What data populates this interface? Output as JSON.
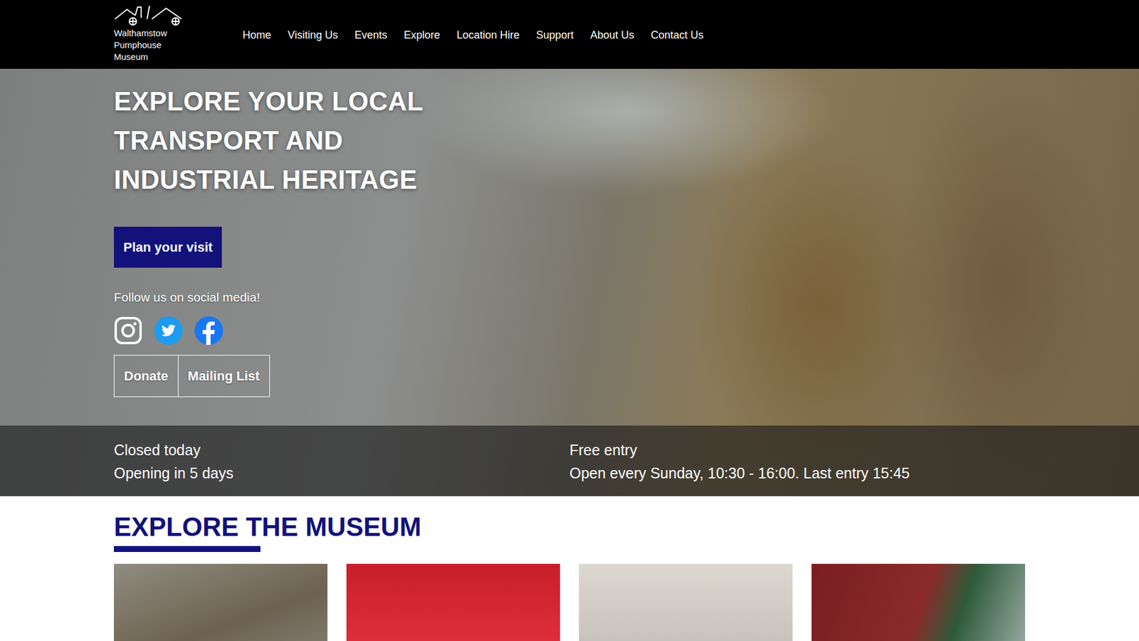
{
  "header": {
    "logo_lines": [
      "Walthamstow",
      "Pumphouse",
      "Museum"
    ],
    "nav": [
      {
        "label": "Home"
      },
      {
        "label": "Visiting Us"
      },
      {
        "label": "Events"
      },
      {
        "label": "Explore"
      },
      {
        "label": "Location Hire"
      },
      {
        "label": "Support"
      },
      {
        "label": "About Us"
      },
      {
        "label": "Contact Us"
      }
    ]
  },
  "hero": {
    "heading": "EXPLORE YOUR LOCAL TRANSPORT AND INDUSTRIAL HERITAGE",
    "plan_button": "Plan your visit",
    "social_label": "Follow us on social media!",
    "actions": [
      "Donate",
      "Mailing List"
    ]
  },
  "status": {
    "today": "Closed today",
    "next": "Opening in 5 days",
    "entry": "Free entry",
    "hours": "Open every Sunday, 10:30 - 16:00. Last entry 15:45"
  },
  "section": {
    "title": "EXPLORE THE MUSEUM"
  }
}
